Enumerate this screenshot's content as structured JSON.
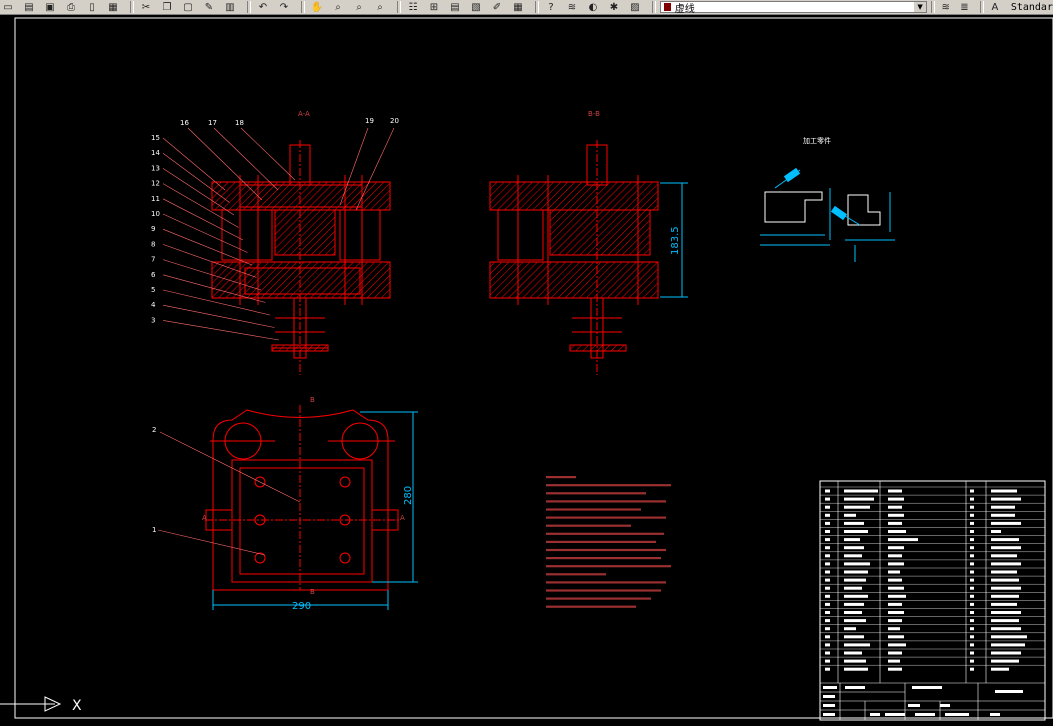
{
  "toolbar": {
    "icons": [
      "new-icon",
      "open-icon",
      "save-icon",
      "print-icon",
      "plot-preview-icon",
      "publish-icon",
      "cut-icon",
      "copy-icon",
      "paste-icon",
      "match-properties-icon",
      "block-editor-icon",
      "undo-icon",
      "redo-icon",
      "pan-icon",
      "zoom-realtime-icon",
      "zoom-window-icon",
      "zoom-previous-icon",
      "properties-icon",
      "design-center-icon",
      "tool-palettes-icon",
      "sheet-set-icon",
      "markup-icon",
      "quickcalc-icon",
      "help-icon",
      "layer-manager-icon",
      "layer-on-icon",
      "layer-freeze-icon",
      "layer-lock-icon"
    ],
    "layer_name": "虚线",
    "layer_color": "#800000",
    "text_style": "Standar"
  },
  "drawing": {
    "section_label_aa": "A-A",
    "section_label_bb": "B-B",
    "part_numbers": [
      "15",
      "14",
      "13",
      "12",
      "11",
      "10",
      "9",
      "8",
      "7",
      "6",
      "5",
      "4",
      "3",
      "16",
      "17",
      "18",
      "19",
      "20",
      "2",
      "1"
    ],
    "dim_height": "183.5",
    "dim_width": "290",
    "dim_depth": "280",
    "view_mark_a": "A",
    "view_mark_b": "B",
    "workpiece_title": "加工零件",
    "ucs_x": "X"
  },
  "colors": {
    "background": "#000000",
    "outline": "#ff0000",
    "hatch": "#ff0000",
    "dimension": "#00bfff",
    "text": "#ffffff",
    "tech_text": "#d04040"
  }
}
